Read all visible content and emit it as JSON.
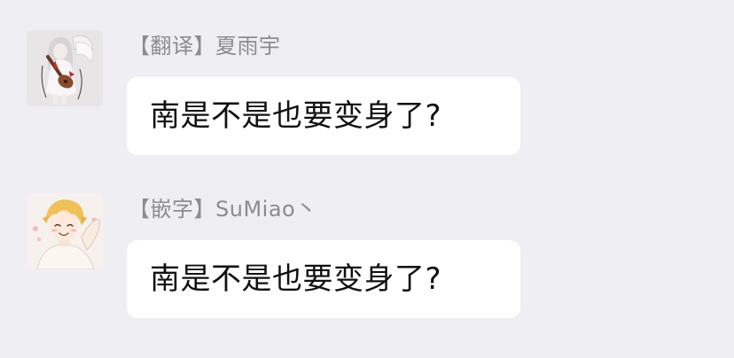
{
  "messages": [
    {
      "sender": "【翻译】夏雨宇",
      "text": "南是不是也要变身了?",
      "avatar_icon": "anime-girl-avatar-icon"
    },
    {
      "sender": "【嵌字】SuMiao丶",
      "text": "南是不是也要变身了?",
      "avatar_icon": "anime-boy-avatar-icon"
    }
  ],
  "colors": {
    "background": "#eeeef3",
    "bubble": "#ffffff",
    "sender_text": "#8b8b91",
    "message_text": "#111111"
  }
}
